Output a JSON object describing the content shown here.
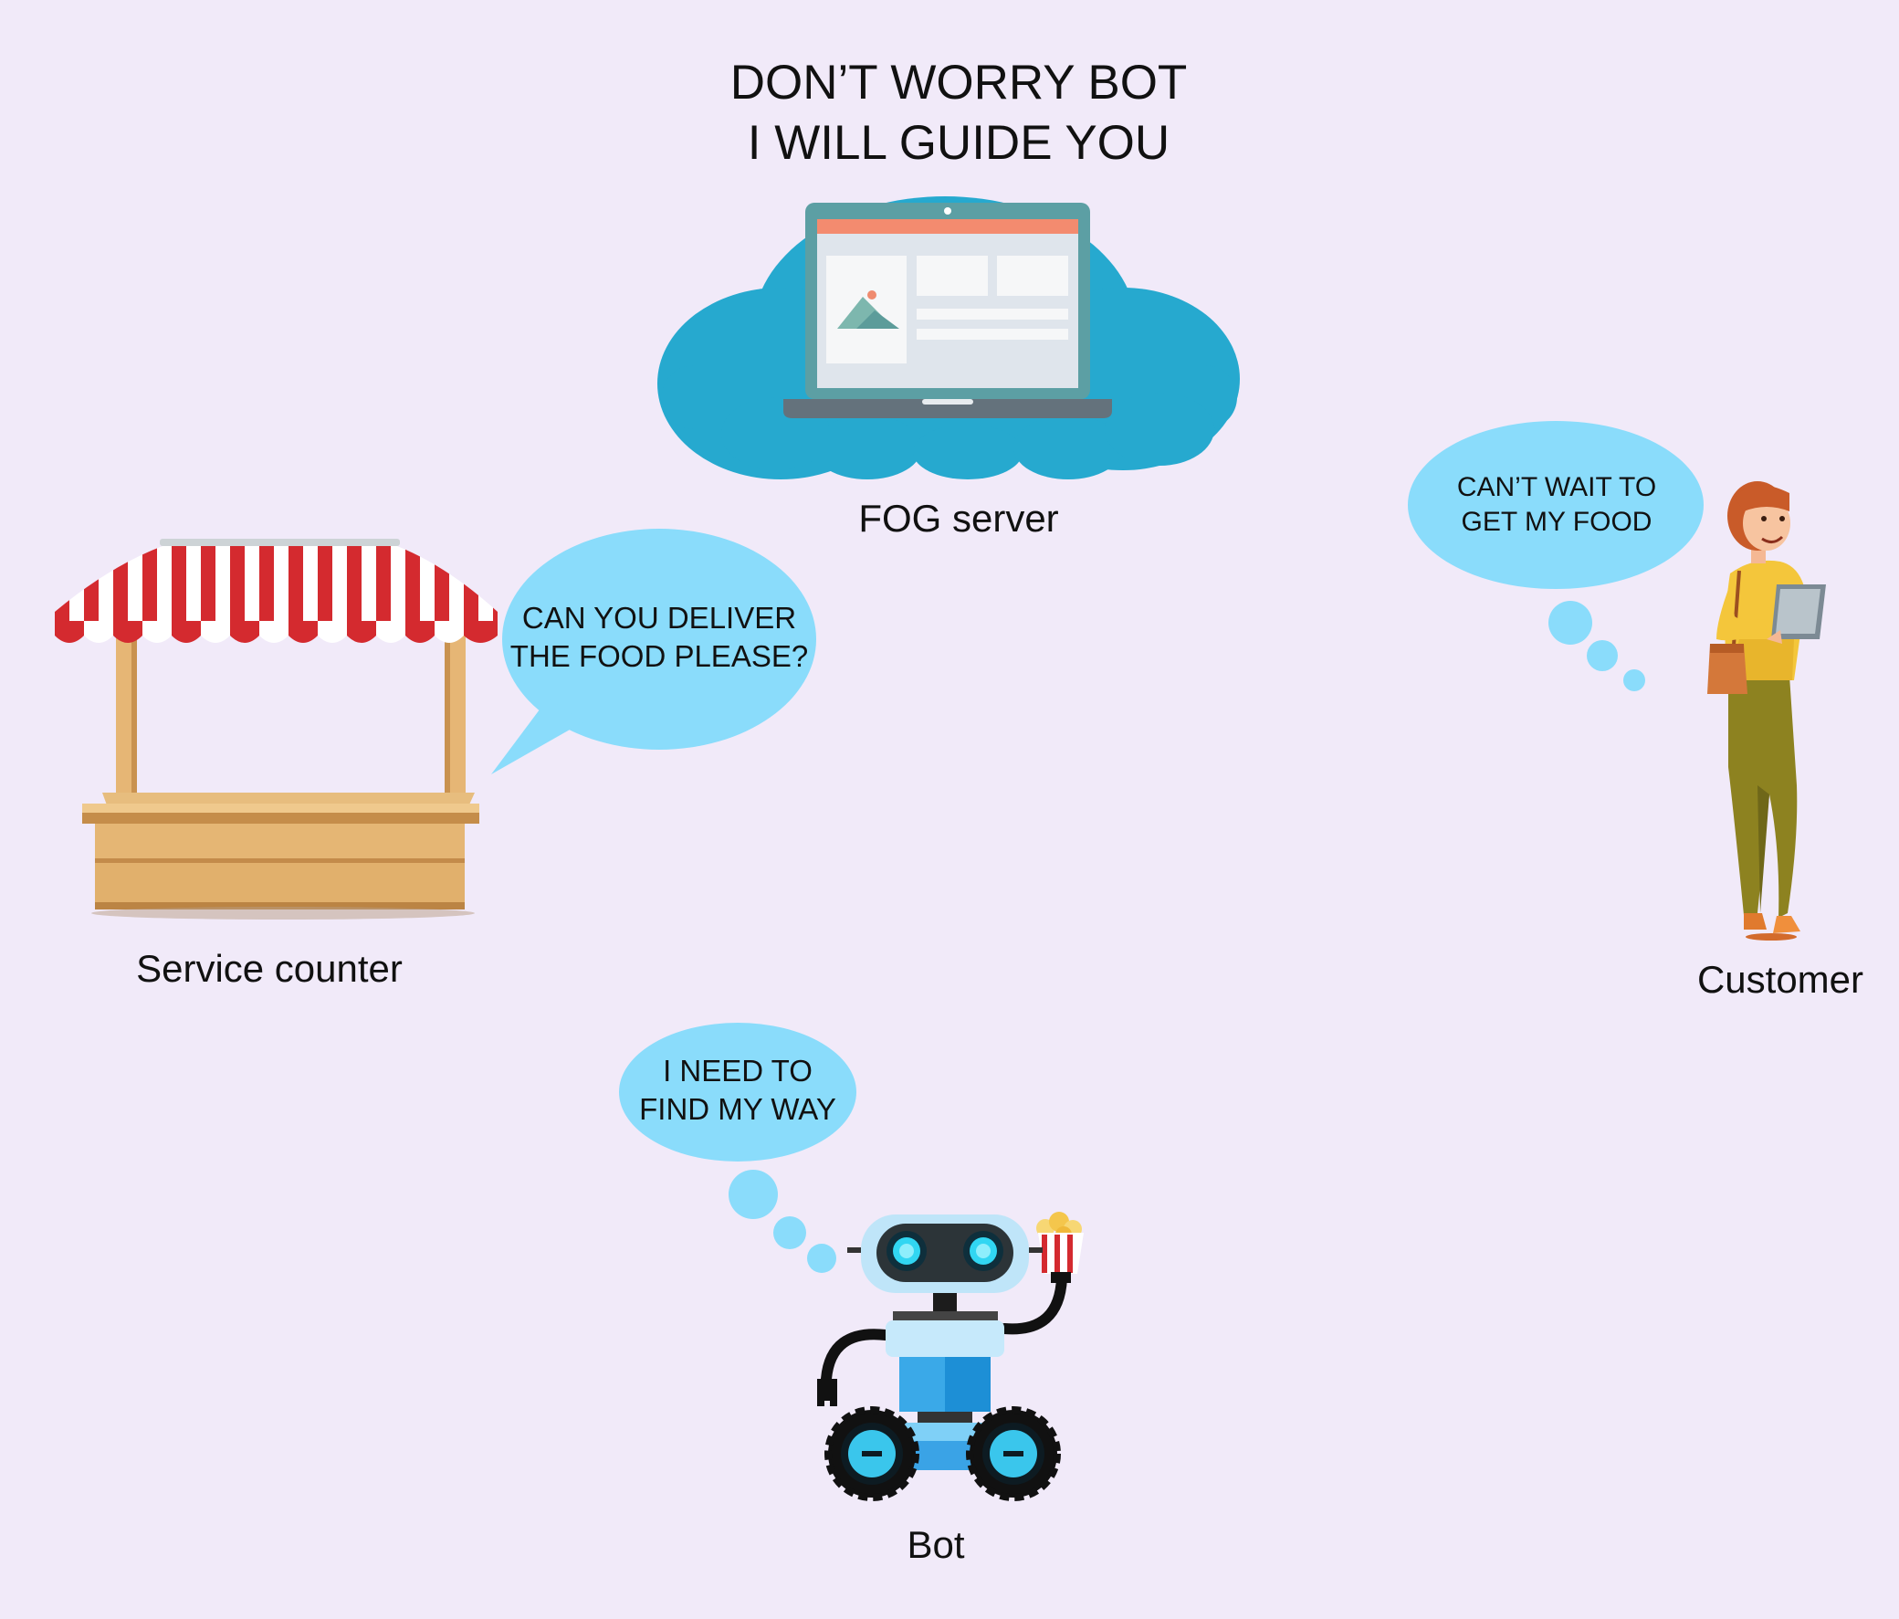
{
  "heading": {
    "line1": "DON’T WORRY BOT",
    "line2": "I WILL GUIDE YOU"
  },
  "fog_server": {
    "label": "FOG server",
    "icon": "cloud-laptop-icon"
  },
  "service_counter": {
    "label": "Service counter",
    "icon": "market-stall-icon",
    "speech": {
      "line1": "CAN YOU DELIVER",
      "line2": "THE FOOD PLEASE?"
    }
  },
  "customer": {
    "label": "Customer",
    "icon": "woman-with-tablet-icon",
    "thought": {
      "line1": "CAN’T WAIT TO",
      "line2": "GET MY FOOD"
    }
  },
  "bot": {
    "label": "Bot",
    "icon": "robot-icon",
    "thought": {
      "line1": "I NEED TO",
      "line2": "FIND MY WAY"
    }
  },
  "colors": {
    "background": "#f1eaf9",
    "cloud": "#26a9cf",
    "bubble": "#8adcfb",
    "awning_red": "#d42a2f",
    "wood": "#e2b573",
    "robot_body": "#3aa3e6"
  }
}
